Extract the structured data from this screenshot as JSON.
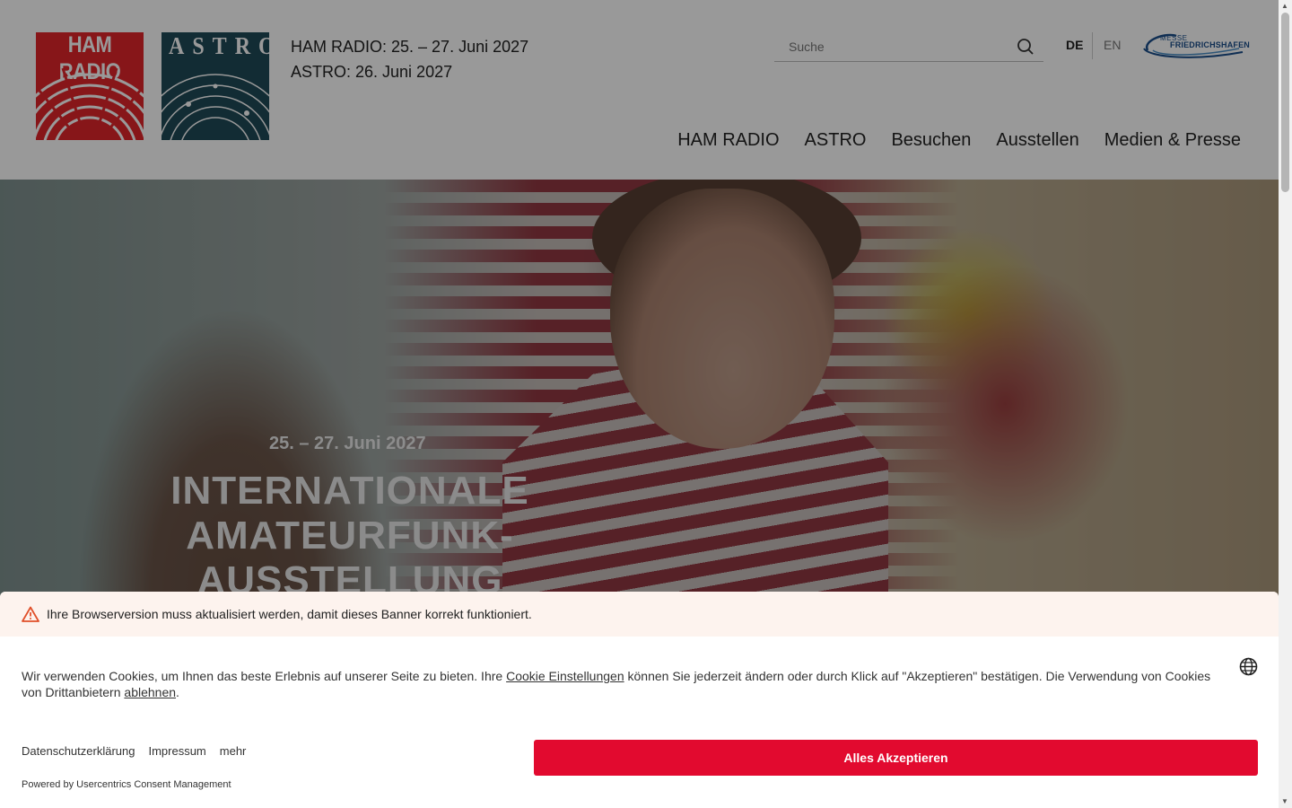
{
  "header": {
    "logo_ham": "HAM RADIO",
    "logo_astro": "ASTRO",
    "dates": [
      "HAM RADIO: 25. – 27. Juni 2027",
      "ASTRO: 26. Juni 2027"
    ],
    "search_placeholder": "Suche",
    "search_icon": "search-icon",
    "lang_de": "DE",
    "lang_en": "EN",
    "messe_logo_small": "MESSE",
    "messe_logo_big": "FRIEDRICHSHAFEN"
  },
  "nav": {
    "items": [
      "HAM RADIO",
      "ASTRO",
      "Besuchen",
      "Ausstellen",
      "Medien & Presse"
    ]
  },
  "hero": {
    "subtitle": "25. – 27. Juni 2027",
    "title_lines": [
      "INTERNATIONALE",
      "AMATEURFUNK-",
      "AUSSTELLUNG"
    ]
  },
  "consent": {
    "warning_icon": "warning-icon",
    "warning": "Ihre Browserversion muss aktualisiert werden, damit dieses Banner korrekt funktioniert.",
    "text_before": "Wir verwenden Cookies, um Ihnen das beste Erlebnis auf unserer Seite zu bieten. Ihre ",
    "link_settings": "Cookie Einstellungen",
    "text_middle": " können Sie jederzeit ändern oder durch Klick auf \"Akzeptieren\" bestätigen. Die Verwendung von Cookies von Drittanbietern ",
    "link_decline": "ablehnen",
    "text_after": ".",
    "globe_icon": "globe-icon",
    "footer_links": [
      "Datenschutzerklärung",
      "Impressum",
      "mehr"
    ],
    "accept_label": "Alles Akzeptieren",
    "powered_by": "Powered by Usercentrics Consent Management"
  },
  "colors": {
    "accent": "#e20a2f",
    "ham_red": "#e2262b",
    "astro_teal": "#1f4a57",
    "warning_bg": "#fdf3ee"
  }
}
